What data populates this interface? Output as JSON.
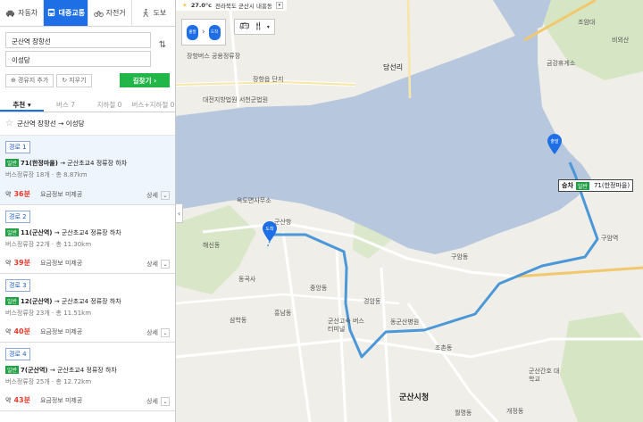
{
  "modes": [
    {
      "label": "자동차",
      "icon": "car-icon",
      "active": false
    },
    {
      "label": "대중교통",
      "icon": "bus-icon",
      "active": true
    },
    {
      "label": "자전거",
      "icon": "bicycle-icon",
      "active": false
    },
    {
      "label": "도보",
      "icon": "walk-icon",
      "active": false
    }
  ],
  "origin": "군산역 장항선",
  "destination": "이성당",
  "add_waypoint": "경유지 추가",
  "clear": "지우기",
  "search": "길찾기",
  "tabs": [
    "추천",
    "버스 7",
    "지하철 0",
    "버스+지하철 0"
  ],
  "favorite_text": "군산역 장항선 → 이성당",
  "routes": [
    {
      "label": "경로 1",
      "badge": "일반",
      "line": "71(한정마을)",
      "transfer": "→ 군산초교4 정류장 하차",
      "stops": "버스정류장 18개",
      "distance": "총 8.87km",
      "time": "36",
      "fare": "요금정보 미제공",
      "detail": "상세"
    },
    {
      "label": "경로 2",
      "badge": "일반",
      "line": "11(군산역)",
      "transfer": "→ 군산초교4 정류장 하차",
      "stops": "버스정류장 22개",
      "distance": "총 11.30km",
      "time": "39",
      "fare": "요금정보 미제공",
      "detail": "상세"
    },
    {
      "label": "경로 3",
      "badge": "일반",
      "line": "12(군산역)",
      "transfer": "→ 군산초교4 정류장 하차",
      "stops": "버스정류장 23개",
      "distance": "총 11.51km",
      "time": "40",
      "fare": "요금정보 미제공",
      "detail": "상세"
    },
    {
      "label": "경로 4",
      "badge": "일반",
      "line": "7(군산역)",
      "transfer": "→ 군산초교4 정류장 하차",
      "stops": "버스정류장 25개",
      "distance": "총 12.72km",
      "time": "43",
      "fare": "요금정보 미제공",
      "detail": "상세"
    }
  ],
  "time_prefix": "약",
  "time_unit": "분",
  "map": {
    "weather_temp": "27.0°c",
    "location": "전라북도 군산시 내흥동",
    "mini_start": "출발",
    "mini_end": "도착",
    "start_pin": "출발",
    "end_pin": "도착",
    "transfer_word": "승차",
    "transfer_badge": "일반",
    "transfer_line": "71(한정마을)",
    "labels": [
      "장항버스 공용정류장",
      "장항읍 단지",
      "당선리",
      "대전지방법원 서천군법원",
      "금강휴게소",
      "조암대",
      "비외산",
      "옥도면사무소",
      "군산항",
      "해신동",
      "중앙동",
      "흥남동",
      "삼학동",
      "경암동",
      "동군산병원",
      "조촌동",
      "군산고속 버스터미널",
      "구암동",
      "군산시청",
      "군산간호 대학교",
      "월명동",
      "동곡사",
      "구암역",
      "개정동"
    ]
  },
  "colors": {
    "accent": "#1e6fe5",
    "search_green": "#22b548",
    "time_red": "#e53b2d",
    "water": "#b7c7de",
    "route": "#4b97d8"
  }
}
